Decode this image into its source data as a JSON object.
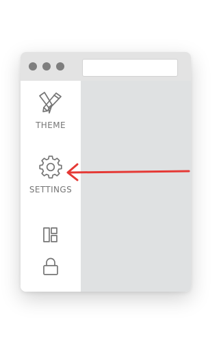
{
  "window": {
    "controls": [
      "close",
      "minimize",
      "maximize"
    ],
    "address_bar_value": ""
  },
  "sidebar": {
    "items": [
      {
        "label": "THEME",
        "icon": "theme-icon"
      },
      {
        "label": "SETTINGS",
        "icon": "gear-icon"
      },
      {
        "label": "",
        "icon": "layout-icon"
      },
      {
        "label": "",
        "icon": "lock-icon"
      }
    ]
  },
  "annotation": {
    "icon": "arrow-left-icon",
    "color": "#e53935",
    "points_to": "sidebar-item-settings"
  },
  "colors": {
    "titlebar": "#e3e3e3",
    "window_dots": "#7e7e7e",
    "content_area": "#dfe1e2",
    "icon_stroke": "#757575"
  }
}
